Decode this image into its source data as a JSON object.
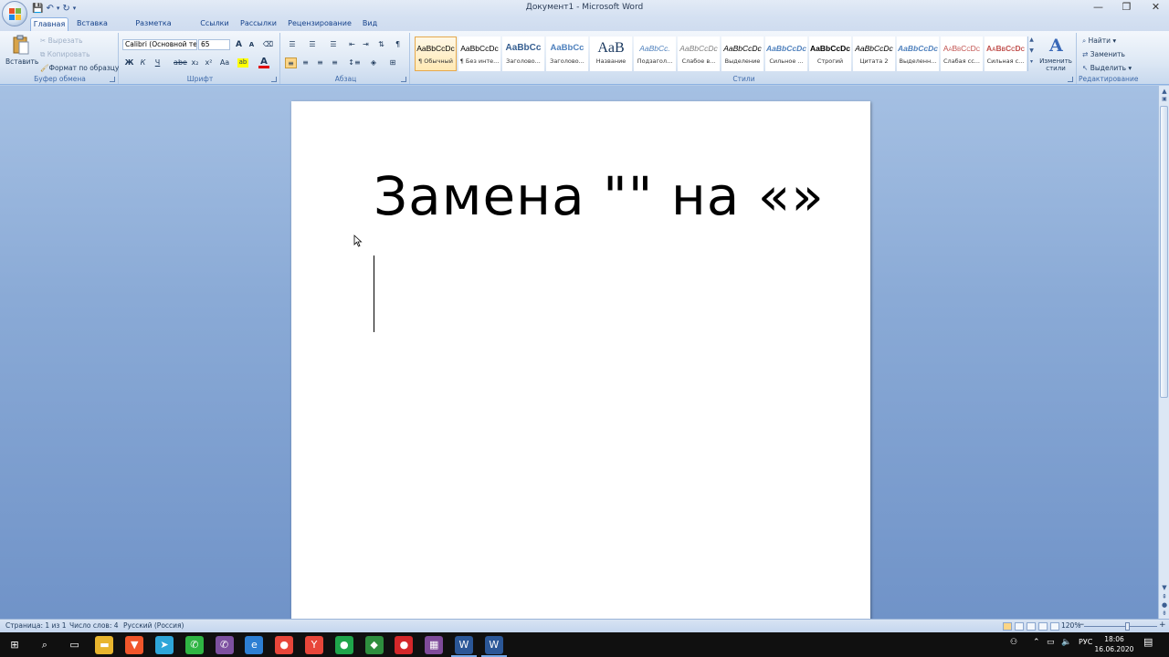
{
  "window": {
    "title": "Документ1 - Microsoft Word",
    "minimize_glyph": "—",
    "restore_glyph": "❐",
    "close_glyph": "✕"
  },
  "quick_access": {
    "save": "💾",
    "undo": "↶",
    "redo": "↻",
    "more": "▾"
  },
  "tabs": [
    "Главная",
    "Вставка",
    "Разметка страницы",
    "Ссылки",
    "Рассылки",
    "Рецензирование",
    "Вид"
  ],
  "ribbon": {
    "clipboard": {
      "label": "Буфер обмена",
      "paste": "Вставить",
      "cut": "Вырезать",
      "copy": "Копировать",
      "format_painter": "Формат по образцу"
    },
    "font": {
      "label": "Шрифт",
      "font_name": "Calibri (Основной текст)",
      "font_size": "65",
      "bold": "Ж",
      "italic": "К",
      "underline": "Ч",
      "strike": "abe",
      "subscript": "x₂",
      "superscript": "x²",
      "case": "Aa",
      "grow": "A",
      "shrink": "A",
      "clear": "⌫"
    },
    "paragraph": {
      "label": "Абзац",
      "pilcrow": "¶"
    },
    "styles": {
      "label": "Стили",
      "items": [
        {
          "sample": "AaBbCcDc",
          "name": "¶ Обычный"
        },
        {
          "sample": "AaBbCcDc",
          "name": "¶ Без инте..."
        },
        {
          "sample": "AaBbCc",
          "name": "Заголово..."
        },
        {
          "sample": "AaBbCc",
          "name": "Заголово..."
        },
        {
          "sample": "AaB",
          "name": "Название"
        },
        {
          "sample": "AaBbCc.",
          "name": "Подзагол..."
        },
        {
          "sample": "AaBbCcDc",
          "name": "Слабое в..."
        },
        {
          "sample": "AaBbCcDc",
          "name": "Выделение"
        },
        {
          "sample": "AaBbCcDc",
          "name": "Сильное ..."
        },
        {
          "sample": "AaBbCcDc",
          "name": "Строгий"
        },
        {
          "sample": "AaBbCcDc",
          "name": "Цитата 2"
        },
        {
          "sample": "AaBbCcDc",
          "name": "Выделенн..."
        },
        {
          "sample": "AaBbCcDc",
          "name": "Слабая сс..."
        },
        {
          "sample": "AaBbCcDc",
          "name": "Сильная с..."
        }
      ],
      "change_styles": "Изменить стили"
    },
    "editing": {
      "label": "Редактирование",
      "find": "Найти",
      "replace": "Заменить",
      "select": "Выделить"
    }
  },
  "document": {
    "heading": "Замена \"\" на «»"
  },
  "status": {
    "page": "Страница: 1 из 1",
    "words": "Число слов: 4",
    "language": "Русский (Россия)",
    "zoom": "120%",
    "zoom_fraction": 0.6
  },
  "taskbar": {
    "lang": "РУС",
    "time": "18:06",
    "date": "16.06.2020",
    "apps": [
      {
        "name": "start",
        "glyph": "⊞",
        "color": "#101010"
      },
      {
        "name": "search",
        "glyph": "⌕",
        "color": "#101010"
      },
      {
        "name": "task-view",
        "glyph": "▭",
        "color": "#101010"
      },
      {
        "name": "explorer",
        "glyph": "▬",
        "color": "#e8b52e"
      },
      {
        "name": "brave",
        "glyph": "▼",
        "color": "#f1562b"
      },
      {
        "name": "telegram",
        "glyph": "➤",
        "color": "#2ea6d9"
      },
      {
        "name": "whatsapp",
        "glyph": "✆",
        "color": "#2fb543"
      },
      {
        "name": "viber",
        "glyph": "✆",
        "color": "#7d51a0"
      },
      {
        "name": "edge",
        "glyph": "e",
        "color": "#2d7fd3"
      },
      {
        "name": "chrome",
        "glyph": "●",
        "color": "#e8463a"
      },
      {
        "name": "yandex",
        "glyph": "Y",
        "color": "#e8463a"
      },
      {
        "name": "green-app",
        "glyph": "●",
        "color": "#1fa54b"
      },
      {
        "name": "photo-app",
        "glyph": "◆",
        "color": "#2e8e3e"
      },
      {
        "name": "recorder",
        "glyph": "●",
        "color": "#d4272a"
      },
      {
        "name": "winrar",
        "glyph": "▦",
        "color": "#7f4b9a"
      },
      {
        "name": "word-file",
        "glyph": "W",
        "color": "#2b5797"
      },
      {
        "name": "word",
        "glyph": "W",
        "color": "#2b5797"
      }
    ]
  }
}
